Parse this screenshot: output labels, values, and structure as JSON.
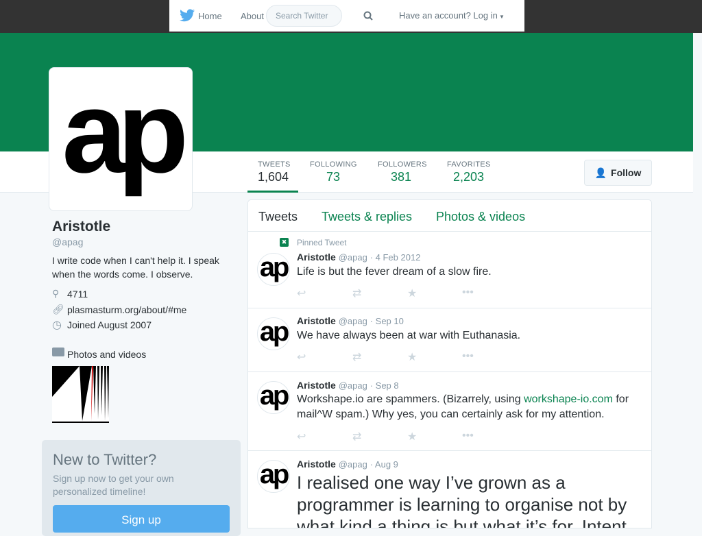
{
  "nav": {
    "home": "Home",
    "about": "About",
    "search_placeholder": "Search Twitter",
    "login": "Have an account? Log in"
  },
  "profile": {
    "avatar_text": "ap",
    "name": "Aristotle",
    "handle": "@apag",
    "bio": "I write code when I can't help it. I speak when the words come. I observe.",
    "location": "4711",
    "url": "plasmasturm.org/about/#me",
    "joined": "Joined August 2007",
    "photos_link": "Photos and videos"
  },
  "stats": [
    {
      "label": "TWEETS",
      "value": "1,604"
    },
    {
      "label": "FOLLOWING",
      "value": "73"
    },
    {
      "label": "FOLLOWERS",
      "value": "381"
    },
    {
      "label": "FAVORITES",
      "value": "2,203"
    }
  ],
  "follow_label": "Follow",
  "tabs": [
    "Tweets",
    "Tweets & replies",
    "Photos & videos"
  ],
  "pinned_label": "Pinned Tweet",
  "tweets": [
    {
      "name": "Aristotle",
      "handle": "@apag",
      "date": "· 4 Feb 2012",
      "text": "Life is but the fever dream of a slow fire."
    },
    {
      "name": "Aristotle",
      "handle": "@apag",
      "date": "· Sep 10",
      "text": "We have always been at war with Euthanasia."
    },
    {
      "name": "Aristotle",
      "handle": "@apag",
      "date": "· Sep 8",
      "text_before": "Workshape.io are spammers. (Bizarrely, using ",
      "link": "workshape-io.com",
      "text_after": " for mail^W spam.) Why yes, you can certainly ask for my attention."
    },
    {
      "name": "Aristotle",
      "handle": "@apag",
      "date": "· Aug 9",
      "text": "I realised one way I’ve grown as a programmer is learning to organise not by what kind a thing is but what it’s for. Intent"
    }
  ],
  "signup": {
    "title": "New to Twitter?",
    "text": "Sign up now to get your own personalized timeline!",
    "button": "Sign up"
  },
  "colors": {
    "accent": "#0a8350",
    "twitter_blue": "#55acee"
  }
}
